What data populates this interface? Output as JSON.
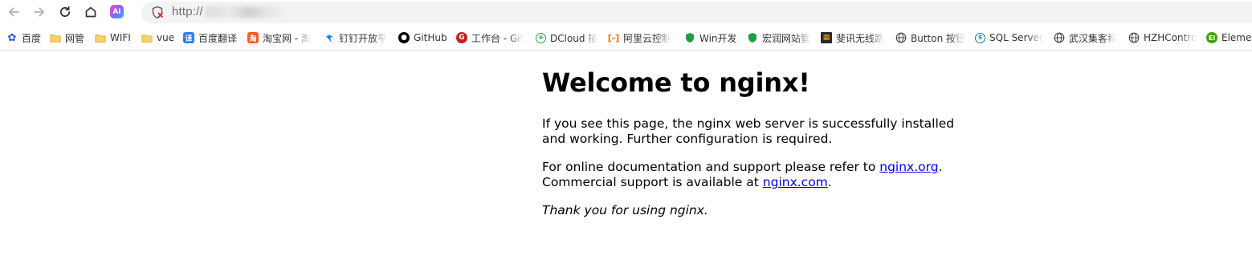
{
  "browser": {
    "ai_label": "AI",
    "url_prefix": "http://"
  },
  "bookmarks": [
    {
      "label": "百度",
      "icon": "baidu-paw-icon",
      "color": "#2b4fe0"
    },
    {
      "label": "网管",
      "icon": "folder-icon",
      "color": "#f2c34e"
    },
    {
      "label": "WIFI",
      "icon": "folder-icon",
      "color": "#f2c34e"
    },
    {
      "label": "vue",
      "icon": "folder-icon",
      "color": "#f2c34e"
    },
    {
      "label": "百度翻译",
      "icon": "translate-icon",
      "color": "#2e7cf6"
    },
    {
      "label": "淘宝网 - 淘",
      "icon": "taobao-icon",
      "color": "#ff5a1f"
    },
    {
      "label": "钉钉开放平",
      "icon": "dingtalk-icon",
      "color": "#1677ff"
    },
    {
      "label": "GitHub",
      "icon": "github-icon",
      "color": "#000000"
    },
    {
      "label": "工作台 - Git",
      "icon": "gitee-icon",
      "color": "#c71d23"
    },
    {
      "label": "DCloud 插",
      "icon": "dcloud-icon",
      "color": "#2ba245"
    },
    {
      "label": "阿里云控制",
      "icon": "aliyun-icon",
      "color": "#ff6a00"
    },
    {
      "label": "Win开发",
      "icon": "shield-green-icon",
      "color": "#1e9e4a"
    },
    {
      "label": "宏润网站管",
      "icon": "shield-green-icon",
      "color": "#1e9e4a"
    },
    {
      "label": "斐讯无线路",
      "icon": "phicomm-icon",
      "color": "#d08a00"
    },
    {
      "label": "Button 按钮",
      "icon": "globe-icon",
      "color": "#555555"
    },
    {
      "label": "SQL Server",
      "icon": "sqlserver-icon",
      "color": "#1a73c8"
    },
    {
      "label": "武汉集客科",
      "icon": "globe-icon",
      "color": "#555555"
    },
    {
      "label": "HZHContro",
      "icon": "globe-icon",
      "color": "#555555"
    },
    {
      "label": "Element",
      "icon": "element-icon",
      "color": "#3ca50a"
    }
  ],
  "page": {
    "title": "Welcome to nginx!",
    "p1": "If you see this page, the nginx web server is successfully installed and working. Further configuration is required.",
    "p2_before": "For online documentation and support please refer to ",
    "p2_link": "nginx.org",
    "p2_mid": ".",
    "p2_line2_before": "Commercial support is available at ",
    "p2_link2": "nginx.com",
    "p2_end": ".",
    "p3": "Thank you for using nginx."
  },
  "colors": {
    "link": "#0000ee",
    "omnibox_bg": "#f1f3f4"
  }
}
